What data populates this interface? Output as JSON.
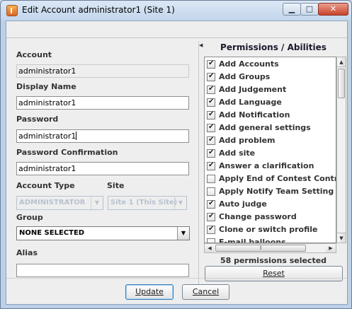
{
  "window": {
    "title": "Edit Account administrator1 (Site 1)",
    "min_glyph": "▁",
    "max_glyph": "□",
    "close_glyph": "✕"
  },
  "form": {
    "account_label": "Account",
    "account_value": "administrator1",
    "display_name_label": "Display Name",
    "display_name_value": "administrator1",
    "password_label": "Password",
    "password_value": "administrator1",
    "password_confirm_label": "Password Confirmation",
    "password_confirm_value": "administrator1",
    "account_type_label": "Account Type",
    "account_type_value": "ADMINISTRATOR",
    "site_label": "Site",
    "site_value": "Site 1 (This Site)",
    "group_label": "Group",
    "group_value": "NONE SELECTED",
    "alias_label": "Alias",
    "alias_value": ""
  },
  "permissions": {
    "title": "Permissions / Abilities",
    "items": [
      {
        "label": "Add Accounts",
        "checked": true
      },
      {
        "label": "Add Groups",
        "checked": true
      },
      {
        "label": "Add Judgement",
        "checked": true
      },
      {
        "label": "Add Language",
        "checked": true
      },
      {
        "label": "Add Notification",
        "checked": true
      },
      {
        "label": "Add general settings",
        "checked": true
      },
      {
        "label": "Add problem",
        "checked": true
      },
      {
        "label": "Add site",
        "checked": true
      },
      {
        "label": "Answer a clarification",
        "checked": true
      },
      {
        "label": "Apply End of Contest Controls",
        "checked": false
      },
      {
        "label": "Apply Notify Team Setting to Board",
        "checked": false
      },
      {
        "label": "Auto judge",
        "checked": true
      },
      {
        "label": "Change password",
        "checked": true
      },
      {
        "label": "Clone or switch profile",
        "checked": true
      },
      {
        "label": "E-mail balloons",
        "checked": false
      }
    ],
    "count_text": "58 permissions selected",
    "reset_label": "Reset"
  },
  "buttons": {
    "update_label": "Update",
    "cancel_label": "Cancel"
  },
  "icons": {
    "app": "java-cup-icon",
    "dropdown": "chevron-down-icon",
    "check": "checkmark-icon"
  }
}
